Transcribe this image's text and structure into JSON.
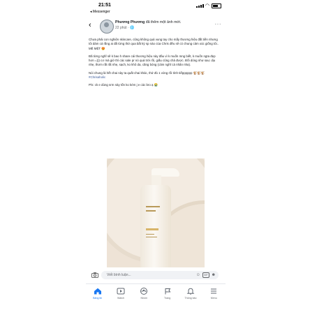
{
  "status_bar": {
    "time": "21:51",
    "back_app": "◂ Messenger"
  },
  "post": {
    "poster_name": "Phương Phương",
    "action": "đã thêm một ảnh mới.",
    "time": "22 phút · ",
    "paragraphs": [
      "Chưa phải con nghiện skincare, cũng không quá vung tay cho mấy thương hiệu đắt tiền nhưng tôi dám cá rằng ai đã từng thử qua bất kỳ sp nào của Chris đều sẽ có chung cảm xúc giống tôi.. MÊ MỆT 😍",
      "Đã từng nghĩ sẽ k bao h share cái thương hiệu này đâu vì k muốn mng biết, k muốn ngta đẹp hơn =))) cơ mà giờ thì các sale pr nó quá trời rồi, giấu cũng chả được. Đối dòng như sau: dịu nhẹ, thơm rất rất nhẹ, sạch, ko khô da, căng bóng (cảm nghĩ cá nhân nha).",
      "Nói chung là hết chai này ta quất chai khác, thử đủ 1 vòng rồi tính tiếpppppp 🐒🐒🐒"
    ],
    "hashtag": "#Chrisaholic",
    "ps": "P/s: ck e dùng srm này tốn ko kém j e các bro ạ 😭"
  },
  "comment_bar": {
    "placeholder": "Viết bình luận..."
  },
  "bottom_nav": {
    "items": [
      {
        "label": "Bảng tin",
        "icon": "home-icon"
      },
      {
        "label": "Watch",
        "icon": "watch-icon"
      },
      {
        "label": "Nhóm",
        "icon": "groups-icon"
      },
      {
        "label": "Trang",
        "icon": "flag-icon"
      },
      {
        "label": "Thông báo",
        "icon": "bell-icon"
      },
      {
        "label": "Menu",
        "icon": "menu-icon"
      }
    ]
  },
  "colors": {
    "accent": "#1877f2",
    "hashtag": "#385898"
  }
}
